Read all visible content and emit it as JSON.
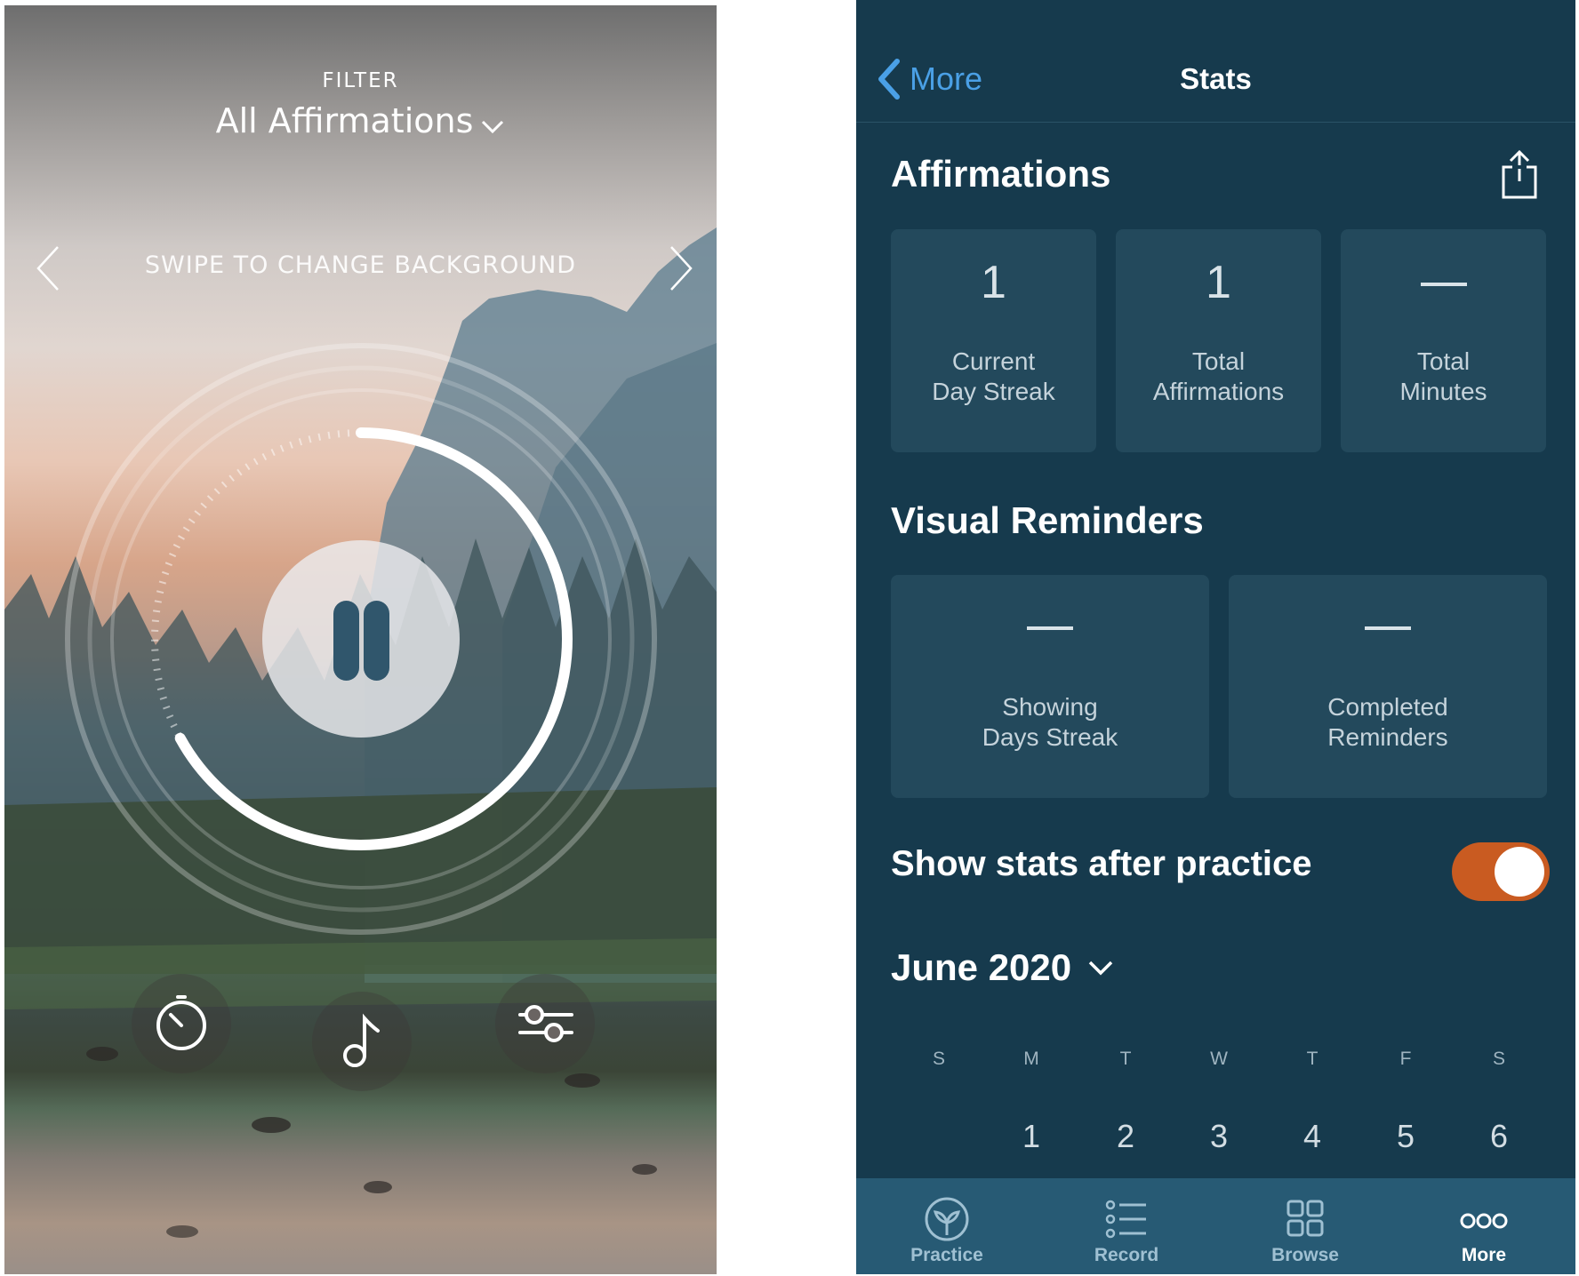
{
  "player": {
    "filter_label": "FILTER",
    "filter_value": "All Affirmations",
    "swipe_hint": "SWIPE TO CHANGE BACKGROUND",
    "progress": 0.67,
    "controls": [
      "timer-icon",
      "music-note-icon",
      "sliders-icon"
    ]
  },
  "stats": {
    "nav": {
      "back_label": "More",
      "title": "Stats"
    },
    "affirmations": {
      "title": "Affirmations",
      "cards": [
        {
          "value": "1",
          "label1": "Current",
          "label2": "Day Streak"
        },
        {
          "value": "1",
          "label1": "Total",
          "label2": "Affirmations"
        },
        {
          "value": "",
          "label1": "Total",
          "label2": "Minutes"
        }
      ]
    },
    "reminders": {
      "title": "Visual Reminders",
      "cards": [
        {
          "value": "",
          "label1": "Showing",
          "label2": "Days Streak"
        },
        {
          "value": "",
          "label1": "Completed",
          "label2": "Reminders"
        }
      ]
    },
    "show_stats": {
      "label": "Show stats after practice",
      "enabled": true
    },
    "calendar": {
      "month": "June 2020",
      "weekdays": [
        "S",
        "M",
        "T",
        "W",
        "T",
        "F",
        "S"
      ],
      "first_week": [
        "",
        "1",
        "2",
        "3",
        "4",
        "5",
        "6"
      ]
    },
    "tabs": [
      {
        "label": "Practice",
        "icon": "sprout-icon"
      },
      {
        "label": "Record",
        "icon": "list-icon"
      },
      {
        "label": "Browse",
        "icon": "grid-icon"
      },
      {
        "label": "More",
        "icon": "more-dots-icon",
        "active": true
      }
    ],
    "colors": {
      "accent_toggle": "#c95b21",
      "background": "#163a4d",
      "card": "#23495c",
      "link": "#4aa0e6"
    }
  }
}
